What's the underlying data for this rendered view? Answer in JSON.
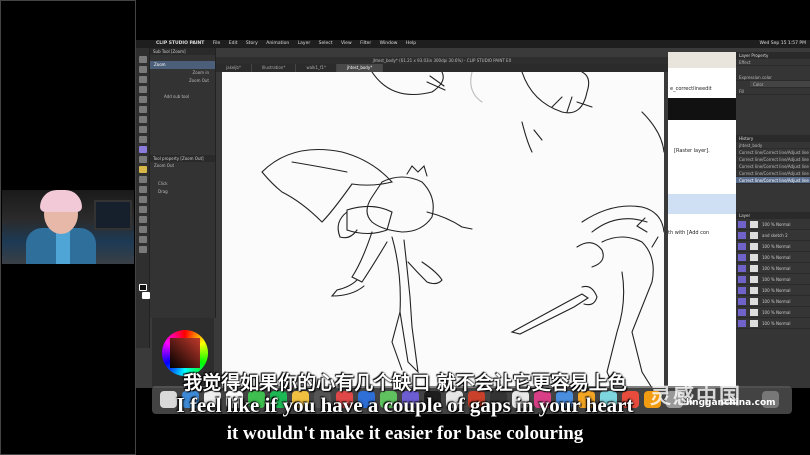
{
  "menubar": {
    "items": [
      "CLIP STUDIO PAINT",
      "File",
      "Edit",
      "Story",
      "Animation",
      "Layer",
      "Select",
      "View",
      "Filter",
      "Window",
      "Help"
    ],
    "clock": "Wed Sep 15  1:57 PM"
  },
  "window_title": "jhtest_body* (61.21 x 93.03in 300dpi 30.6%) - CLIP STUDIO PAINT EX",
  "doc_tabs": [
    "jakeljb*",
    "Illustration*",
    "walk1_f1*",
    "jhtest_body*"
  ],
  "subtool": {
    "header": "Sub Tool [Zoom]",
    "items": [
      "Zoom",
      "Zoom in",
      "Zoom Out"
    ],
    "add_label": "Add sub tool"
  },
  "tool_property": {
    "header": "Tool property [Zoom Out]",
    "name": "Zoom Out",
    "rows": [
      "Click",
      "Drag"
    ]
  },
  "right_doc": {
    "line1": "e_correctlineedit",
    "line2": "[Raster layer].",
    "line3": "th with [Add con"
  },
  "layer_property": {
    "header": "Layer Property",
    "effect": "Effect",
    "expression": "Expression color",
    "color": "Color",
    "fill": "Fill"
  },
  "history": {
    "header": "History",
    "file": "jhtest_body",
    "items": [
      "Correct line/Correct line/Adjust line width",
      "Correct line/Correct line/Adjust line width",
      "Correct line/Correct line/Adjust line width",
      "Correct line/Correct line/Adjust line width",
      "Correct line/Correct line/Adjust line width"
    ]
  },
  "layers": {
    "header": "Layer",
    "items": [
      "100 % Normal",
      "and sketch 2",
      "100 % Normal",
      "100 % Normal",
      "100 % Normal",
      "100 % Normal",
      "100 % Normal",
      "100 % Normal",
      "100 % Normal",
      "100 % Normal"
    ]
  },
  "subtitles": {
    "cn": "我觉得如果你的心有几个缺口 就不会让它更容易上色",
    "en1": "I feel like if you have a couple of gaps in your heart",
    "en2": "it wouldn't make it easier for base colouring"
  },
  "watermark": {
    "main": "灵感中国",
    "url": "lingganchina.com"
  },
  "colors": {
    "menubar": "#1e1e1e",
    "panel": "#353535",
    "canvas": "#fbfbfb",
    "selection": "#5a6d8c",
    "layer_mark": "#6f62c8"
  }
}
